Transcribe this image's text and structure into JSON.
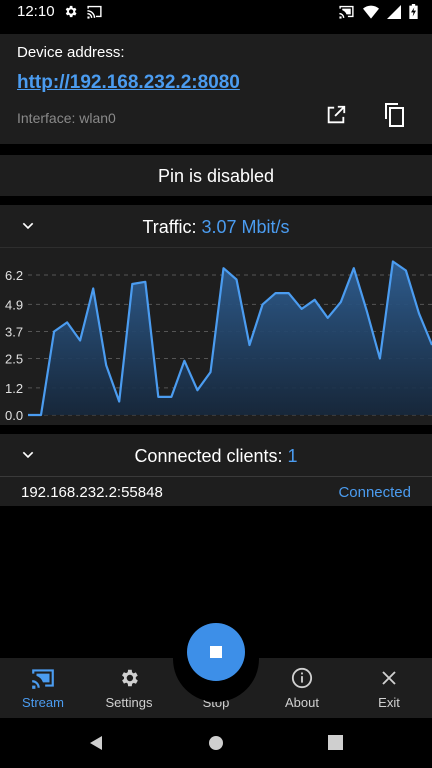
{
  "status_bar": {
    "time": "12:10"
  },
  "device": {
    "label": "Device address:",
    "url": "http://192.168.232.2:8080",
    "interface": "Interface: wlan0"
  },
  "pin": {
    "text": "Pin is disabled"
  },
  "traffic": {
    "label": "Traffic:",
    "value": "3.07 Mbit/s"
  },
  "chart_data": {
    "type": "area",
    "y_ticks": [
      "6.2",
      "4.9",
      "3.7",
      "2.5",
      "1.2",
      "0.0"
    ],
    "ylim": [
      0,
      6.2
    ],
    "grid": true,
    "values": [
      0,
      0,
      3.7,
      4.1,
      3.3,
      5.6,
      2.2,
      0.6,
      5.8,
      5.9,
      0.8,
      0.8,
      2.4,
      1.1,
      1.9,
      6.5,
      6.0,
      3.1,
      4.9,
      5.4,
      5.4,
      4.7,
      5.1,
      4.3,
      5.0,
      6.5,
      4.6,
      2.5,
      6.8,
      6.4,
      4.5,
      3.1
    ]
  },
  "clients": {
    "label": "Connected clients:",
    "count": "1",
    "items": [
      {
        "address": "192.168.232.2:55848",
        "status": "Connected"
      }
    ]
  },
  "bottom_nav": {
    "items": [
      {
        "label": "Stream",
        "icon": "cast-icon",
        "active": true
      },
      {
        "label": "Settings",
        "icon": "gear-icon",
        "active": false
      },
      {
        "label": "Stop",
        "icon": "stop-icon",
        "active": false
      },
      {
        "label": "About",
        "icon": "info-icon",
        "active": false
      },
      {
        "label": "Exit",
        "icon": "close-icon",
        "active": false
      }
    ]
  },
  "colors": {
    "accent": "#4b9cf0",
    "card_bg": "#1e1e1e",
    "background": "#000000",
    "fab": "#3d8fe8"
  }
}
